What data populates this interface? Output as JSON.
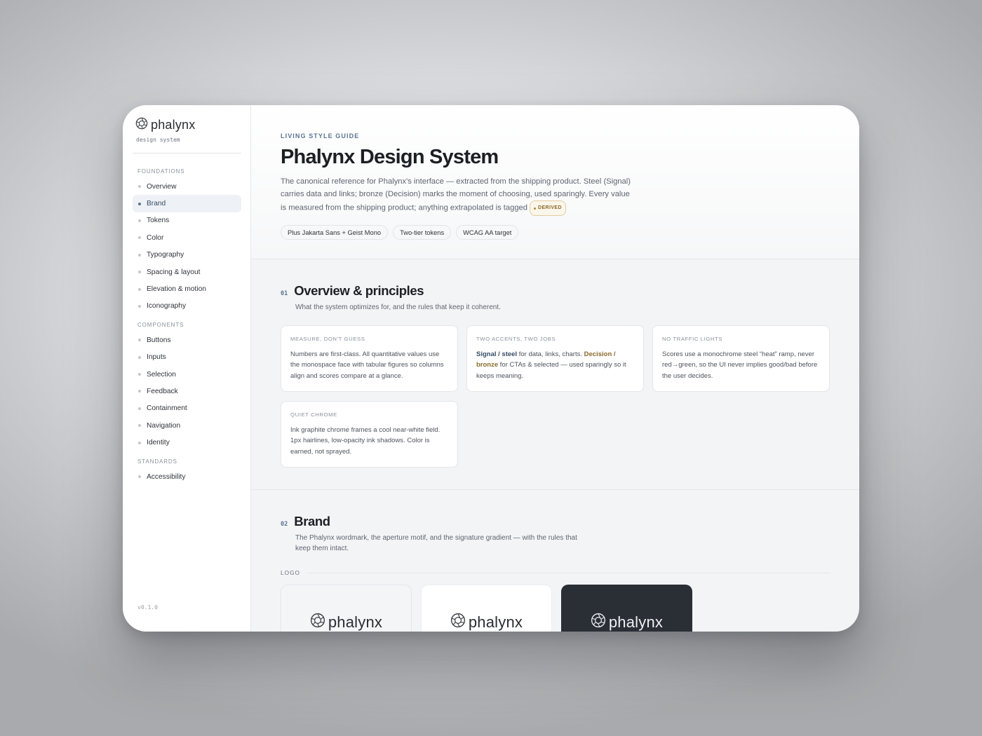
{
  "sidebar": {
    "brand": {
      "wordmark": "phalynx",
      "subtitle": "design system",
      "icon": "aperture-icon"
    },
    "groups": [
      {
        "label": "FOUNDATIONS",
        "items": [
          {
            "label": "Overview"
          },
          {
            "label": "Brand",
            "active": true
          },
          {
            "label": "Tokens"
          },
          {
            "label": "Color"
          },
          {
            "label": "Typography"
          },
          {
            "label": "Spacing & layout"
          },
          {
            "label": "Elevation & motion"
          },
          {
            "label": "Iconography"
          }
        ]
      },
      {
        "label": "COMPONENTS",
        "items": [
          {
            "label": "Buttons"
          },
          {
            "label": "Inputs"
          },
          {
            "label": "Selection"
          },
          {
            "label": "Feedback"
          },
          {
            "label": "Containment"
          },
          {
            "label": "Navigation"
          },
          {
            "label": "Identity"
          }
        ]
      },
      {
        "label": "STANDARDS",
        "items": [
          {
            "label": "Accessibility"
          }
        ]
      }
    ],
    "version": "v0.1.0"
  },
  "hero": {
    "eyebrow": "LIVING STYLE GUIDE",
    "title": "Phalynx Design System",
    "lead": "The canonical reference for Phalynx's interface — extracted from the shipping product. Steel (Signal) carries data and links; bronze (Decision) marks the moment of choosing, used sparingly. Every value is measured from the shipping product; anything extrapolated is tagged",
    "derived_badge": "DERIVED",
    "chips": [
      "Plus Jakarta Sans + Geist Mono",
      "Two-tier tokens",
      "WCAG AA target"
    ]
  },
  "overview": {
    "number": "01",
    "title": "Overview & principles",
    "description": "What the system optimizes for, and the rules that keep it coherent.",
    "cards": [
      {
        "label": "MEASURE, DON'T GUESS",
        "body": "Numbers are first-class. All quantitative values use the monospace face with tabular figures so columns align and scores compare at a glance."
      },
      {
        "label": "TWO ACCENTS, TWO JOBS",
        "signal": "Signal / steel",
        "mid": " for data, links, charts. ",
        "decision": "Decision / bronze",
        "tail": " for CTAs & selected — used sparingly so it keeps meaning."
      },
      {
        "label": "NO TRAFFIC LIGHTS",
        "body": "Scores use a monochrome steel “heat” ramp, never red→green, so the UI never implies good/bad before the user decides."
      },
      {
        "label": "QUIET CHROME",
        "body": "Ink graphite chrome frames a cool near-white field. 1px hairlines, low-opacity ink shadows. Color is earned, not sprayed."
      }
    ]
  },
  "brand": {
    "number": "02",
    "title": "Brand",
    "description": "The Phalynx wordmark, the aperture motif, and the signature gradient — with the rules that keep them intact.",
    "logo_label": "LOGO",
    "logo_tiles": [
      {
        "wordmark": "phalynx",
        "variant": "light-gray"
      },
      {
        "wordmark": "phalynx",
        "variant": "white"
      },
      {
        "wordmark": "phalynx",
        "variant": "dark"
      }
    ]
  },
  "colors": {
    "accent_signal": "#364b66",
    "accent_decision": "#8a6a2c",
    "ink": "#1c1f24"
  }
}
